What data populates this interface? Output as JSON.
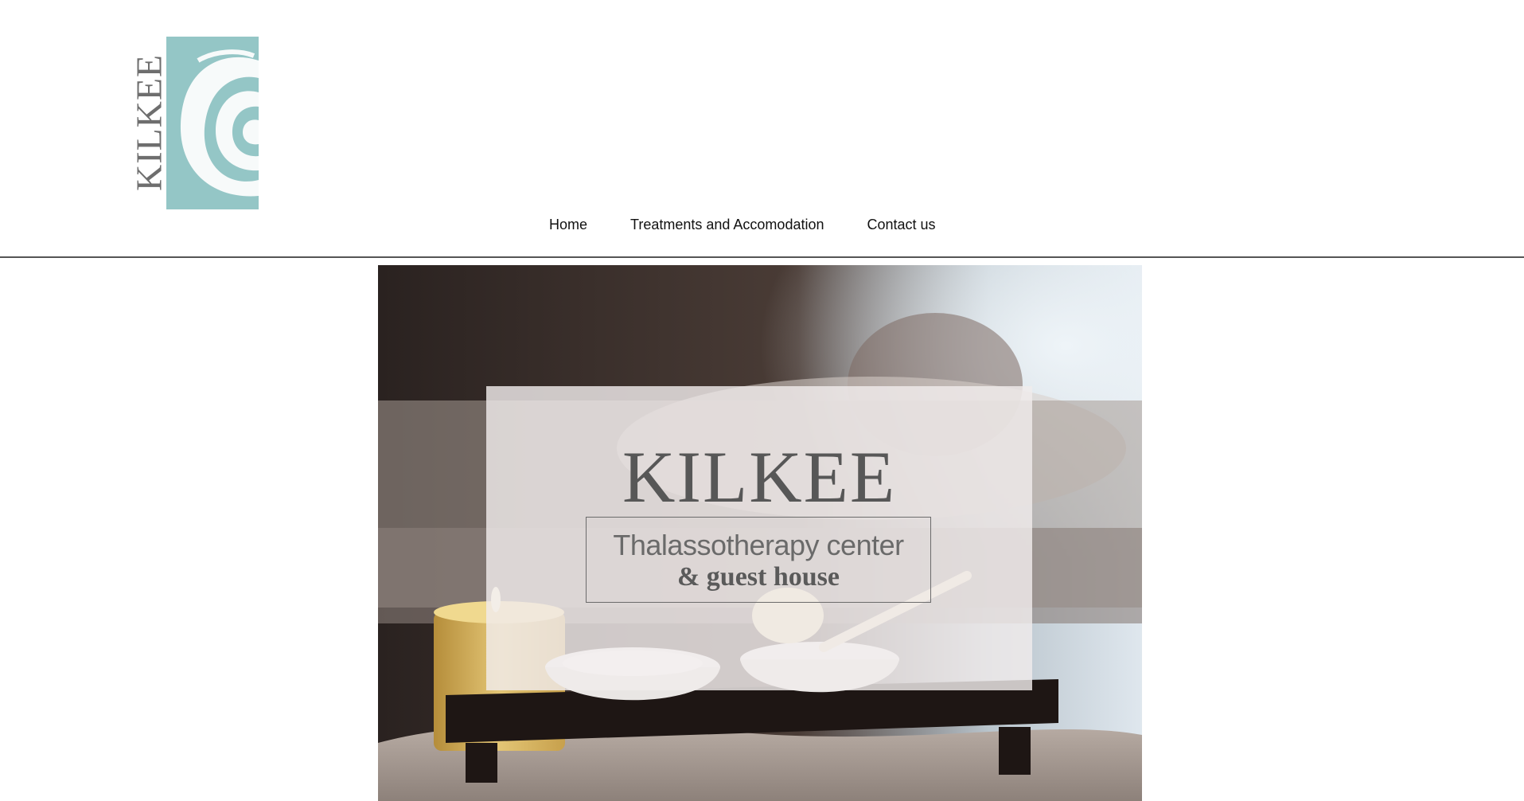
{
  "logo": {
    "text": "KILKEE",
    "brand_color": "#94c6c6",
    "text_color": "#6e6e6e"
  },
  "nav": {
    "items": [
      {
        "label": "Home"
      },
      {
        "label": "Treatments and Accomodation"
      },
      {
        "label": "Contact us"
      }
    ]
  },
  "hero": {
    "title": "KILKEE",
    "subtitle_line1": "Thalassotherapy center",
    "subtitle_line2": "& guest house"
  }
}
